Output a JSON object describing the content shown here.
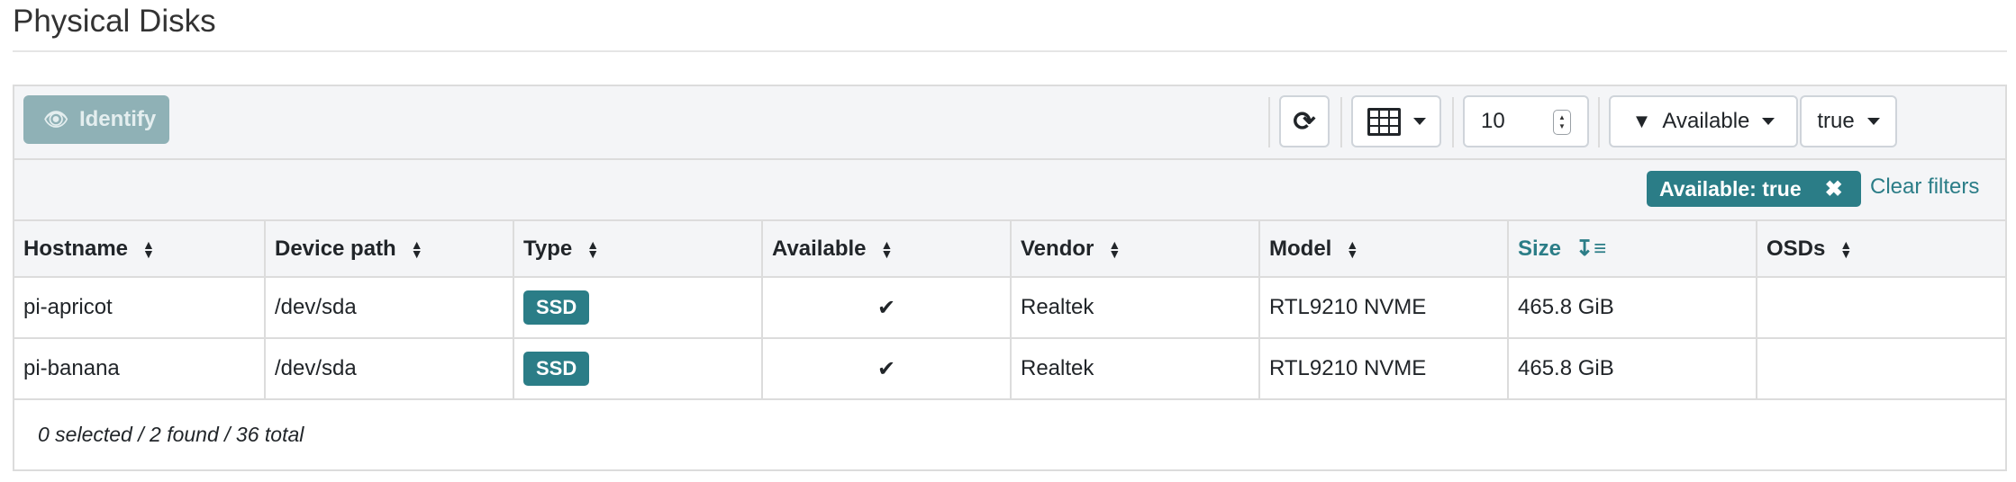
{
  "page": {
    "title": "Physical Disks"
  },
  "toolbar": {
    "identify_label": "Identify",
    "page_size": "10",
    "filter_label": "Available",
    "filter_value": "true"
  },
  "filters": {
    "active_chip": "Available: true",
    "clear_label": "Clear filters"
  },
  "table": {
    "columns": [
      "Hostname",
      "Device path",
      "Type",
      "Available",
      "Vendor",
      "Model",
      "Size",
      "OSDs"
    ],
    "sorted_column": "Size",
    "rows": [
      {
        "hostname": "pi-apricot",
        "device_path": "/dev/sda",
        "type": "SSD",
        "available": "✔",
        "vendor": "Realtek",
        "model": "RTL9210 NVME",
        "size": "465.8 GiB",
        "osds": ""
      },
      {
        "hostname": "pi-banana",
        "device_path": "/dev/sda",
        "type": "SSD",
        "available": "✔",
        "vendor": "Realtek",
        "model": "RTL9210 NVME",
        "size": "465.8 GiB",
        "osds": ""
      }
    ]
  },
  "footer": {
    "summary": "0 selected / 2 found / 36 total"
  },
  "colors": {
    "accent": "#2b7d87",
    "identify_disabled": "#8fb1b6",
    "toolbar_bg": "#f4f5f7",
    "border": "#dcdcdc"
  },
  "icons": {
    "identify": "eye-icon",
    "refresh": "refresh-icon",
    "columns": "table-columns-icon",
    "filter": "filter-icon",
    "remove_filter": "close-icon",
    "sort": "sort-icon",
    "sort_desc": "sort-amount-desc-icon",
    "available": "check-icon"
  }
}
